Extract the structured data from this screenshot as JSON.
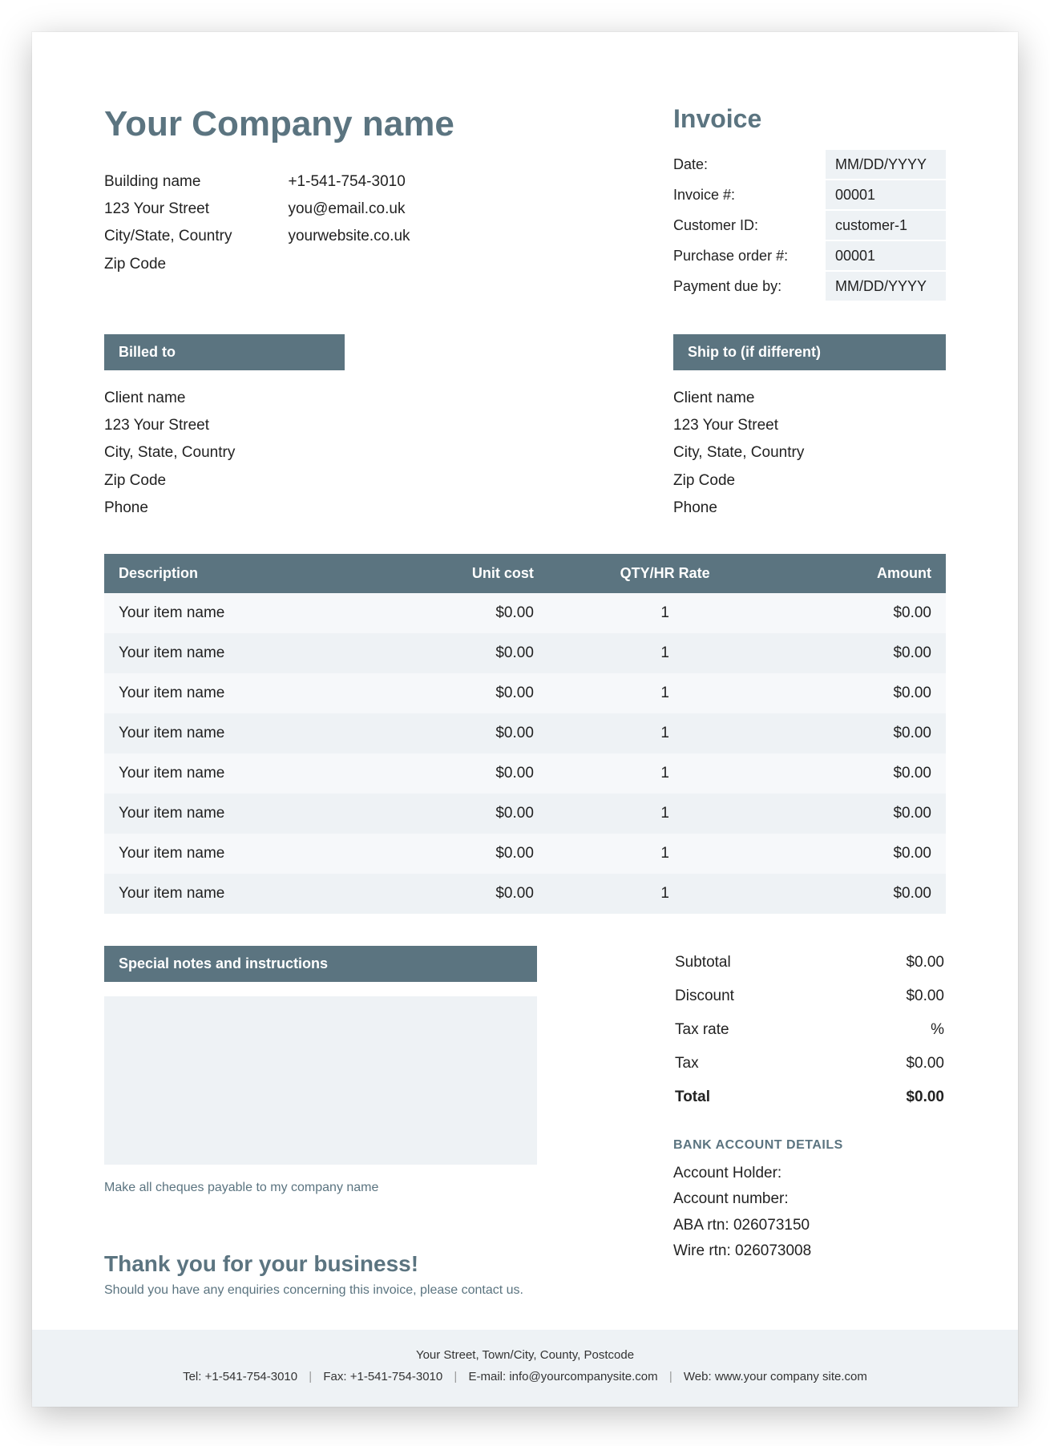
{
  "company": {
    "name": "Your Company name",
    "address": {
      "building": "Building name",
      "street": "123 Your Street",
      "city_state_country": "City/State, Country",
      "zip": "Zip Code"
    },
    "contact": {
      "phone": "+1-541-754-3010",
      "email": "you@email.co.uk",
      "website": "yourwebsite.co.uk"
    }
  },
  "invoice": {
    "title": "Invoice",
    "meta": [
      {
        "label": "Date:",
        "value": "MM/DD/YYYY"
      },
      {
        "label": "Invoice #:",
        "value": "00001"
      },
      {
        "label": "Customer ID:",
        "value": "customer-1"
      },
      {
        "label": "Purchase order #:",
        "value": "00001"
      },
      {
        "label": "Payment due by:",
        "value": "MM/DD/YYYY"
      }
    ]
  },
  "billed_to": {
    "header": "Billed to",
    "lines": [
      "Client name",
      "123 Your Street",
      "City, State, Country",
      "Zip Code",
      "Phone"
    ]
  },
  "ship_to": {
    "header": "Ship to (if different)",
    "lines": [
      "Client name",
      "123 Your Street",
      "City, State, Country",
      "Zip Code",
      "Phone"
    ]
  },
  "items": {
    "headers": {
      "description": "Description",
      "unit_cost": "Unit cost",
      "qty": "QTY/HR Rate",
      "amount": "Amount"
    },
    "rows": [
      {
        "description": "Your item name",
        "unit_cost": "$0.00",
        "qty": "1",
        "amount": "$0.00"
      },
      {
        "description": "Your item name",
        "unit_cost": "$0.00",
        "qty": "1",
        "amount": "$0.00"
      },
      {
        "description": "Your item name",
        "unit_cost": "$0.00",
        "qty": "1",
        "amount": "$0.00"
      },
      {
        "description": "Your item name",
        "unit_cost": "$0.00",
        "qty": "1",
        "amount": "$0.00"
      },
      {
        "description": "Your item name",
        "unit_cost": "$0.00",
        "qty": "1",
        "amount": "$0.00"
      },
      {
        "description": "Your item name",
        "unit_cost": "$0.00",
        "qty": "1",
        "amount": "$0.00"
      },
      {
        "description": "Your item name",
        "unit_cost": "$0.00",
        "qty": "1",
        "amount": "$0.00"
      },
      {
        "description": "Your item name",
        "unit_cost": "$0.00",
        "qty": "1",
        "amount": "$0.00"
      }
    ]
  },
  "notes": {
    "header": "Special notes and instructions",
    "body": "",
    "cheque_line": "Make all cheques payable to my company name"
  },
  "totals": {
    "rows": [
      {
        "label": "Subtotal",
        "value": "$0.00"
      },
      {
        "label": "Discount",
        "value": "$0.00"
      },
      {
        "label": "Tax rate",
        "value": "%"
      },
      {
        "label": "Tax",
        "value": "$0.00"
      }
    ],
    "total_label": "Total",
    "total_value": "$0.00"
  },
  "bank": {
    "heading": "BANK ACCOUNT DETAILS",
    "lines": [
      "Account Holder:",
      "Account number:",
      "ABA rtn: 026073150",
      "Wire rtn: 026073008"
    ]
  },
  "thanks": {
    "title": "Thank you for your business!",
    "sub": "Should you have any enquiries concerning this invoice, please contact us."
  },
  "footer": {
    "line1": "Your Street, Town/City, County, Postcode",
    "tel_label": "Tel:",
    "tel": "+1-541-754-3010",
    "fax_label": "Fax:",
    "fax": "+1-541-754-3010",
    "email_label": "E-mail:",
    "email": "info@yourcompanysite.com",
    "web_label": "Web:",
    "web": "www.your company site.com"
  }
}
